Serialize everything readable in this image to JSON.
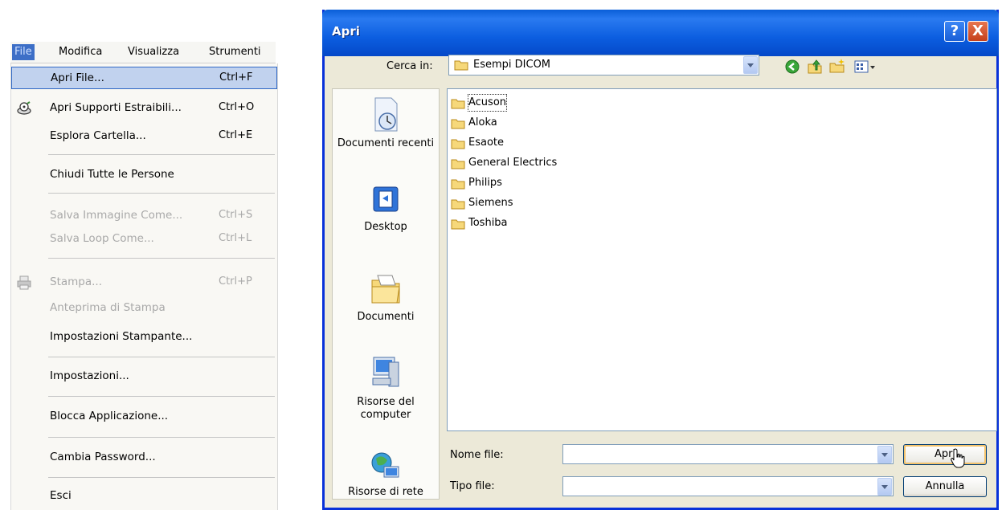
{
  "menubar": {
    "items": [
      "File",
      "Modifica",
      "Visualizza",
      "Strumenti"
    ]
  },
  "file_menu": {
    "items": [
      {
        "label": "Apri File...",
        "shortcut": "Ctrl+F",
        "state": "highlighted"
      },
      {
        "label": "Apri Supporti Estraibili...",
        "shortcut": "Ctrl+O",
        "state": "enabled",
        "icon": "removable-media-icon"
      },
      {
        "label": "Esplora Cartella...",
        "shortcut": "Ctrl+E",
        "state": "enabled"
      },
      {
        "label": "Chiudi Tutte le Persone",
        "shortcut": "",
        "state": "enabled"
      },
      {
        "label": "Salva Immagine Come...",
        "shortcut": "Ctrl+S",
        "state": "disabled"
      },
      {
        "label": "Salva Loop Come...",
        "shortcut": "Ctrl+L",
        "state": "disabled"
      },
      {
        "label": "Stampa...",
        "shortcut": "Ctrl+P",
        "state": "disabled",
        "icon": "printer-icon"
      },
      {
        "label": "Anteprima di Stampa",
        "shortcut": "",
        "state": "disabled"
      },
      {
        "label": "Impostazioni Stampante...",
        "shortcut": "",
        "state": "enabled"
      },
      {
        "label": "Impostazioni...",
        "shortcut": "",
        "state": "enabled"
      },
      {
        "label": "Blocca Applicazione...",
        "shortcut": "",
        "state": "enabled"
      },
      {
        "label": "Cambia Password...",
        "shortcut": "",
        "state": "enabled"
      },
      {
        "label": "Esci",
        "shortcut": "",
        "state": "enabled"
      }
    ]
  },
  "dialog": {
    "title": "Apri",
    "look_in_label": "Cerca in:",
    "look_in_value": "Esempi DICOM",
    "places": [
      "Documenti recenti",
      "Desktop",
      "Documenti",
      "Risorse del computer",
      "Risorse di rete"
    ],
    "folders": [
      "Acuson",
      "Aloka",
      "Esaote",
      "General Electrics",
      "Philips",
      "Siemens",
      "Toshiba"
    ],
    "filename_label": "Nome file:",
    "filename_value": "",
    "filetype_label": "Tipo file:",
    "filetype_value": "",
    "open_button": "Apri",
    "cancel_button": "Annulla",
    "help_button": "?",
    "close_button": "X"
  },
  "colors": {
    "titlebar": "#0a5fd8",
    "menu_highlight": "#c1d2ee",
    "dialog_face": "#ece9d8",
    "disabled_text": "#a9a9a9"
  }
}
